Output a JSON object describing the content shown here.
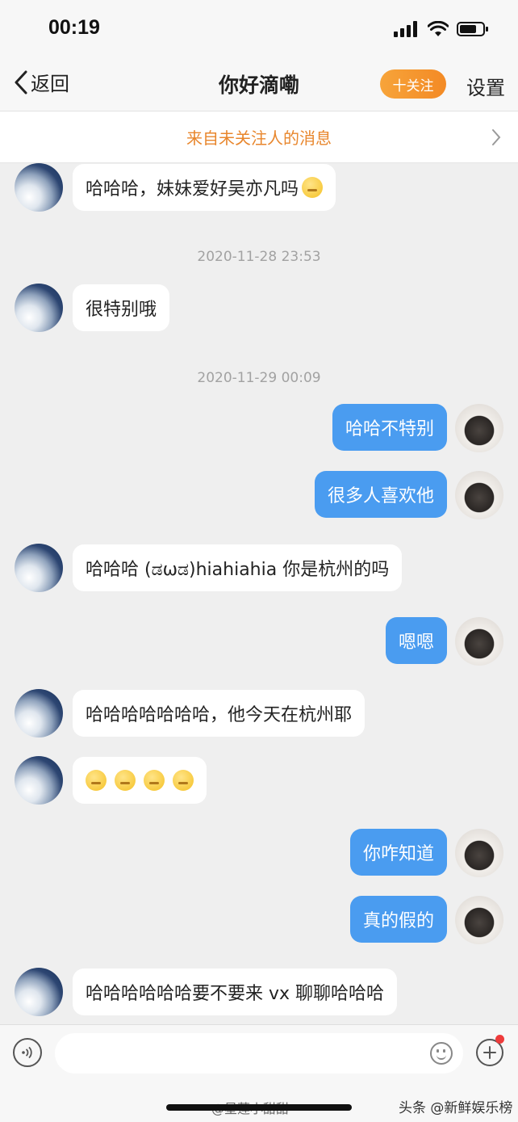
{
  "status_bar": {
    "time": "00:19"
  },
  "nav": {
    "back_label": "返回",
    "title": "你好滴嘞",
    "follow_label": "十关注",
    "settings_label": "设置"
  },
  "notice": {
    "text": "来自未关注人的消息"
  },
  "messages": [
    {
      "side": "in",
      "text": "哈哈哈，妹妹爱好吴亦凡吗",
      "emoji_count": 1
    },
    {
      "timestamp": "2020-11-28 23:53"
    },
    {
      "side": "in",
      "text": "很特别哦",
      "emoji_count": 0
    },
    {
      "timestamp": "2020-11-29 00:09"
    },
    {
      "side": "out",
      "text": "哈哈不特别"
    },
    {
      "side": "out",
      "text": "很多人喜欢他"
    },
    {
      "side": "in",
      "text": "哈哈哈 (ಡωಡ)hiahiahia 你是杭州的吗",
      "emoji_count": 0
    },
    {
      "side": "out",
      "text": "嗯嗯"
    },
    {
      "side": "in",
      "text": "哈哈哈哈哈哈哈，他今天在杭州耶",
      "emoji_count": 0
    },
    {
      "side": "in",
      "text": "",
      "emoji_count": 4
    },
    {
      "side": "out",
      "text": "你咋知道"
    },
    {
      "side": "out",
      "text": "真的假的"
    },
    {
      "side": "in",
      "text": "哈哈哈哈哈哈要不要来 vx 聊聊哈哈哈",
      "emoji_count": 0
    }
  ],
  "input": {
    "placeholder": ""
  },
  "watermark": {
    "left": "@星莲小甜甜",
    "right": "头条 @新鲜娱乐榜"
  },
  "colors": {
    "accent_orange": "#f38a25",
    "bubble_out": "#4a9cf0",
    "background": "#efefef"
  }
}
